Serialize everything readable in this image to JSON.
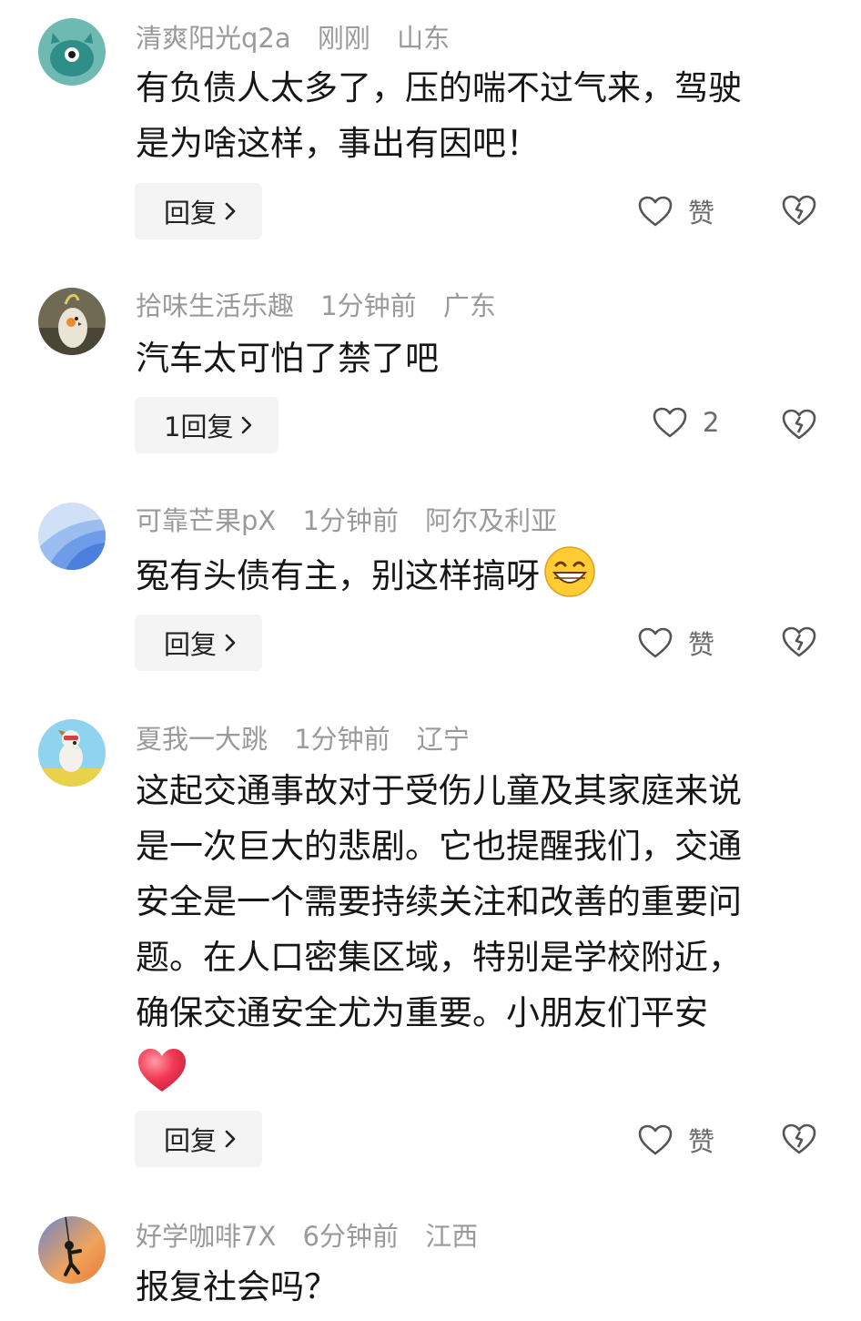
{
  "comments": [
    {
      "user": "清爽阳光q2a",
      "time": "刚刚",
      "location": "山东",
      "lines": [
        "有负债人太多了，压的喘不过气来，驾驶",
        "是为啥这样，事出有因吧！"
      ],
      "reply_label": "回复",
      "like_label": "赞",
      "avatar_icon": "monster-avatar-icon"
    },
    {
      "user": "拾味生活乐趣",
      "time": "1分钟前",
      "location": "广东",
      "lines": [
        "汽车太可怕了禁了吧"
      ],
      "reply_label": "1回复",
      "like_label": "2",
      "avatar_icon": "cockatiel-avatar-icon"
    },
    {
      "user": "可靠芒果pX",
      "time": "1分钟前",
      "location": "阿尔及利亚",
      "lines": [
        "冤有头债有主，别这样搞呀"
      ],
      "reply_label": "回复",
      "like_label": "赞",
      "avatar_icon": "blue-wave-avatar-icon",
      "emoji": "grinning-face-emoji"
    },
    {
      "user": "夏我一大跳",
      "time": "1分钟前",
      "location": "辽宁",
      "lines": [
        "这起交通事故对于受伤儿童及其家庭来说",
        "是一次巨大的悲剧。它也提醒我们，交通",
        "安全是一个需要持续关注和改善的重要问",
        "题。在人口密集区域，特别是学校附近，",
        "确保交通安全尤为重要。小朋友们平安"
      ],
      "reply_label": "回复",
      "like_label": "赞",
      "avatar_icon": "dog-avatar-icon",
      "emoji": "red-heart-emoji"
    },
    {
      "user": "好学咖啡7X",
      "time": "6分钟前",
      "location": "江西",
      "lines": [
        "报复社会吗？"
      ],
      "avatar_icon": "climber-avatar-icon"
    }
  ],
  "colors": {
    "meta_gray": "#9a9a9a",
    "reply_bg": "#f4f4f4",
    "text": "#161616"
  }
}
